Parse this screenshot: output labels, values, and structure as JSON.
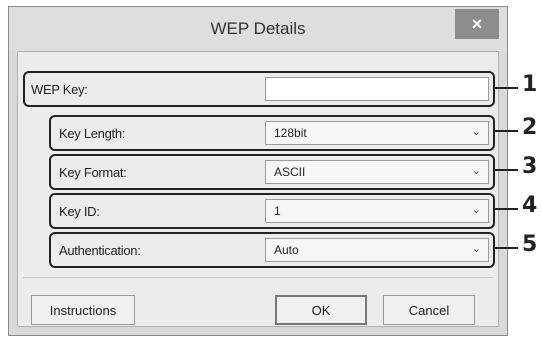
{
  "window": {
    "title": "WEP Details",
    "close_symbol": "×"
  },
  "rows": [
    {
      "label": "WEP Key:",
      "value": "",
      "type": "input",
      "callout": "1"
    },
    {
      "label": "Key Length:",
      "value": "128bit",
      "type": "select",
      "callout": "2"
    },
    {
      "label": "Key Format:",
      "value": "ASCII",
      "type": "select",
      "callout": "3"
    },
    {
      "label": "Key ID:",
      "value": "1",
      "type": "select",
      "callout": "4"
    },
    {
      "label": "Authentication:",
      "value": "Auto",
      "type": "select",
      "callout": "5"
    }
  ],
  "buttons": {
    "instructions": "Instructions",
    "ok": "OK",
    "cancel": "Cancel"
  },
  "icons": {
    "close": "close-icon",
    "dropdown": "chevron-down-icon"
  }
}
